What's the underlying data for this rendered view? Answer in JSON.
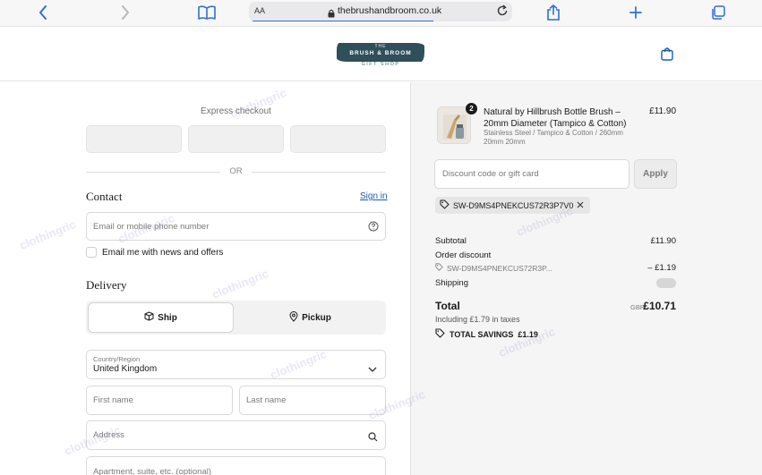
{
  "browser": {
    "text_size_label": "AA",
    "url": "thebrushandbroom.co.uk",
    "icons": [
      "back-icon",
      "forward-icon",
      "bookmarks-icon",
      "lock-icon",
      "reload-icon",
      "share-icon",
      "new-tab-icon",
      "tabs-icon"
    ]
  },
  "header": {
    "logo_top": "THE",
    "logo_main": "BRUSH & BROOM",
    "logo_sub": "GIFT SHOP",
    "bag_icon": "shopping-bag-icon"
  },
  "checkout": {
    "express_label": "Express checkout",
    "or_label": "OR",
    "contact_title": "Contact",
    "sign_in_label": "Sign in",
    "email_placeholder": "Email or mobile phone number",
    "news_label": "Email me with news and offers",
    "delivery_title": "Delivery",
    "ship_label": "Ship",
    "pickup_label": "Pickup",
    "country_label": "Country/Region",
    "country_value": "United Kingdom",
    "first_name_placeholder": "First name",
    "last_name_placeholder": "Last name",
    "address_placeholder": "Address",
    "apartment_placeholder": "Apartment, suite, etc. (optional)"
  },
  "summary": {
    "quantity": "2",
    "product_name": "Natural by Hillbrush Bottle Brush – 20mm Diameter (Tampico & Cotton)",
    "product_variant_line1": "Stainless Steel / Tampico & Cotton / 260mm",
    "product_variant_line2": "20mm 20mm",
    "product_price": "£11.90",
    "discount_placeholder": "Discount code or gift card",
    "apply_label": "Apply",
    "applied_code": "SW-D9MS4PNEKCUS72R3P7V0",
    "subtotal_label": "Subtotal",
    "subtotal_value": "£11.90",
    "order_discount_label": "Order discount",
    "order_discount_code": "SW-D9MS4PNEKCUS72R3P...",
    "order_discount_value": "– £1.19",
    "shipping_label": "Shipping",
    "total_label": "Total",
    "currency": "GBP",
    "total_value": "£10.71",
    "taxes_note": "Including £1.79 in taxes",
    "savings_label": "TOTAL SAVINGS",
    "savings_value": "£1.19"
  },
  "watermark_text": "clothingric",
  "colors": {
    "link": "#1a5dab",
    "logo": "#2f4f5a",
    "summary_bg": "#f5f5f5"
  }
}
